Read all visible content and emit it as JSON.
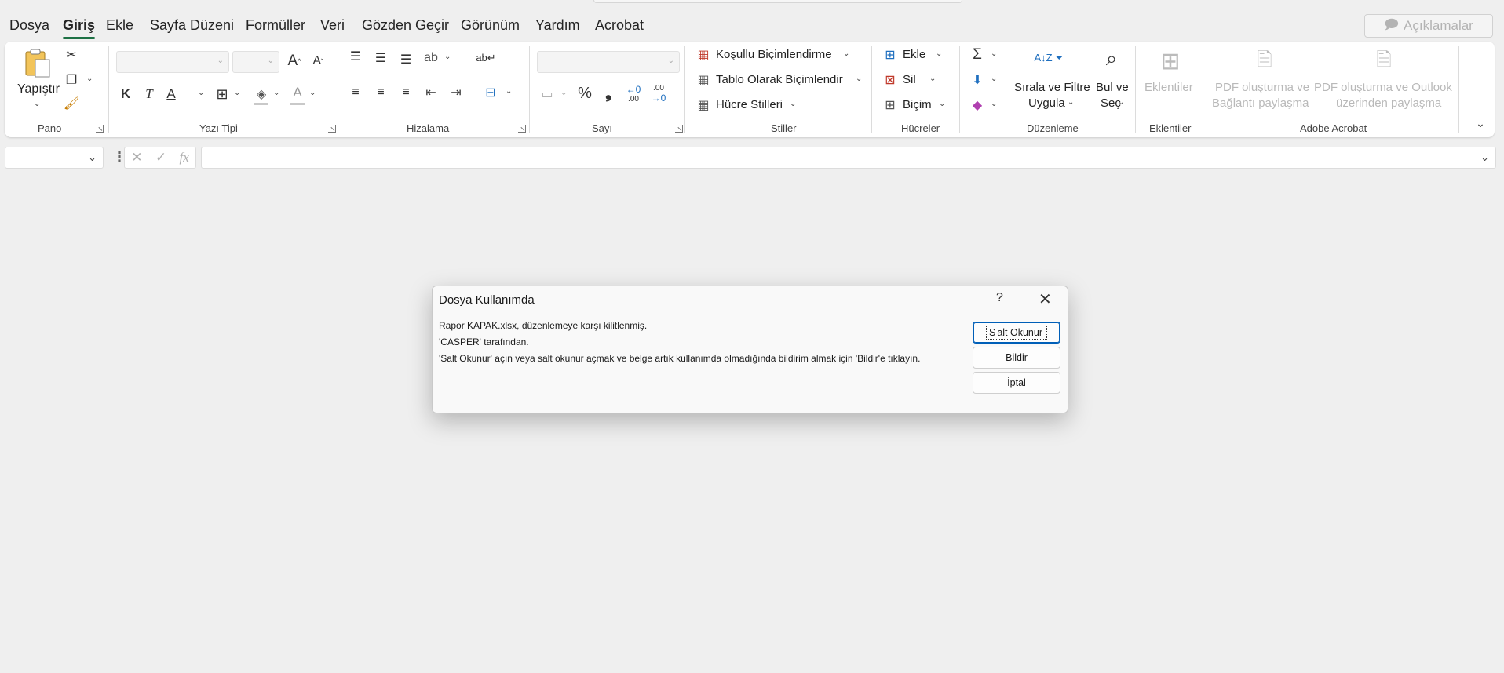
{
  "menu": {
    "items": [
      {
        "label": "Dosya"
      },
      {
        "label": "Giriş",
        "active": true
      },
      {
        "label": "Ekle"
      },
      {
        "label": "Sayfa Düzeni"
      },
      {
        "label": "Formüller"
      },
      {
        "label": "Veri"
      },
      {
        "label": "Gözden Geçir"
      },
      {
        "label": "Görünüm"
      },
      {
        "label": "Yardım"
      },
      {
        "label": "Acrobat"
      }
    ],
    "comments_label": "Açıklamalar"
  },
  "ribbon": {
    "pano": {
      "label": "Pano",
      "paste_label": "Yapıştır"
    },
    "font": {
      "label": "Yazı Tipi",
      "bold": "K",
      "italic": "T",
      "underline": "A",
      "font_color": "A"
    },
    "alignment": {
      "label": "Hizalama"
    },
    "number": {
      "label": "Sayı",
      "percent": "%",
      "comma": "❟",
      "inc_decimal": ".00",
      "dec_decimal": ".00"
    },
    "styles": {
      "label": "Stiller",
      "conditional": "Koşullu Biçimlendirme",
      "as_table": "Tablo Olarak Biçimlendir",
      "cell_styles": "Hücre Stilleri"
    },
    "cells": {
      "label": "Hücreler",
      "insert": "Ekle",
      "delete": "Sil",
      "format": "Biçim"
    },
    "editing": {
      "label": "Düzenleme",
      "sort_filter_line1": "Sırala ve Filtre",
      "sort_filter_line2": "Uygula",
      "find_line1": "Bul ve",
      "find_line2": "Seç"
    },
    "addins": {
      "label": "Eklentiler",
      "button": "Eklentiler"
    },
    "acrobat": {
      "label": "Adobe Acrobat",
      "pdf_share_line1": "PDF oluşturma ve",
      "pdf_share_line2": "Bağlantı paylaşma",
      "pdf_outlook_line1": "PDF oluşturma ve Outlook",
      "pdf_outlook_line2": "üzerinden paylaşma"
    }
  },
  "formula_bar": {
    "fx": "fx",
    "value": ""
  },
  "dialog": {
    "title": "Dosya Kullanımda",
    "help": "?",
    "message_line1": "Rapor KAPAK.xlsx, düzenlemeye karşı kilitlenmiş.",
    "message_line2": "'CASPER' tarafından.",
    "message_line3": "'Salt Okunur' açın veya salt okunur açmak ve belge artık kullanımda olmadığında bildirim almak için 'Bildir'e tıklayın.",
    "btn_readonly_first": "S",
    "btn_readonly_rest": "alt Okunur",
    "btn_notify_first": "B",
    "btn_notify_rest": "ildir",
    "btn_cancel_first": "İ",
    "btn_cancel_rest": "ptal"
  }
}
